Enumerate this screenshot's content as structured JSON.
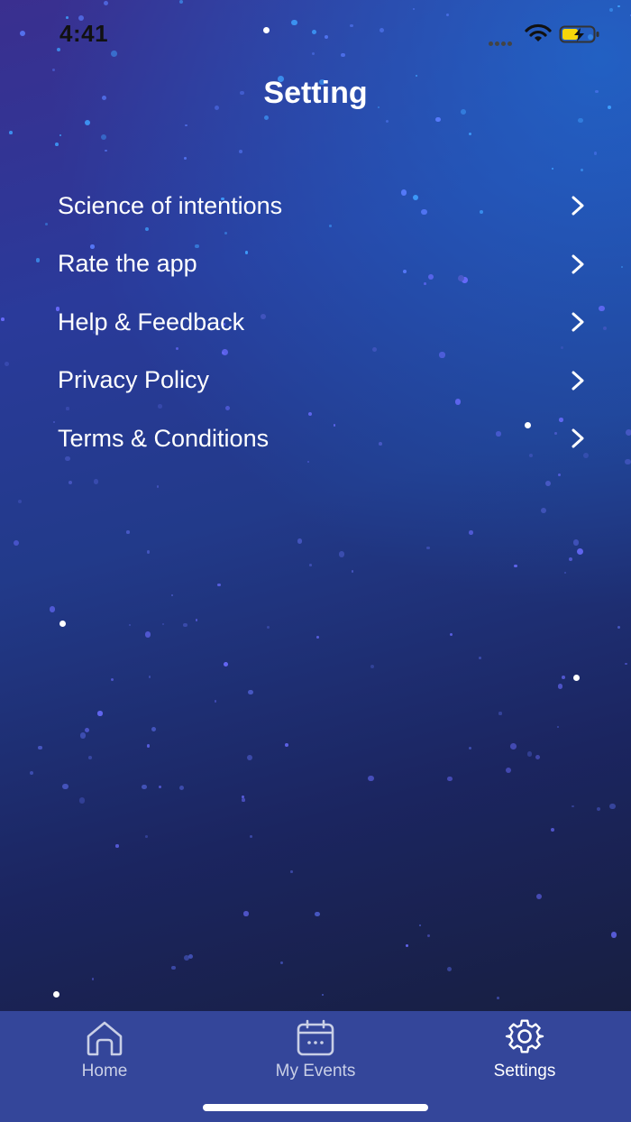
{
  "status_bar": {
    "time": "4:41"
  },
  "header": {
    "title": "Setting"
  },
  "menu": {
    "items": [
      {
        "label": "Science of intentions"
      },
      {
        "label": "Rate the app"
      },
      {
        "label": "Help & Feedback"
      },
      {
        "label": "Privacy Policy"
      },
      {
        "label": "Terms & Conditions"
      }
    ]
  },
  "tab_bar": {
    "tabs": [
      {
        "label": "Home",
        "icon": "home-icon",
        "active": false
      },
      {
        "label": "My Events",
        "icon": "calendar-icon",
        "active": false
      },
      {
        "label": "Settings",
        "icon": "gear-icon",
        "active": true
      }
    ]
  },
  "colors": {
    "tab_bar_bg": "#34469a",
    "battery_fill": "#f5d60a",
    "active_tab": "#ffffff",
    "inactive_tab": "#c9cfe6"
  }
}
